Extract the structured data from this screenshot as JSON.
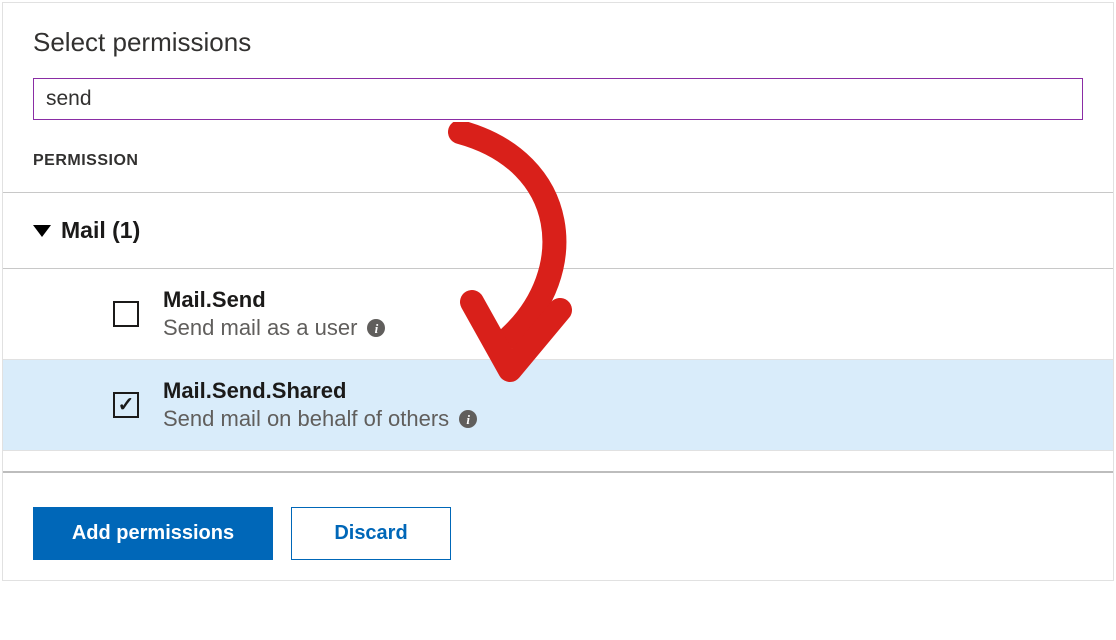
{
  "title": "Select permissions",
  "search": {
    "value": "send"
  },
  "columnHeader": "PERMISSION",
  "group": {
    "label": "Mail (1)"
  },
  "permissions": [
    {
      "name": "Mail.Send",
      "description": "Send mail as a user",
      "checked": false
    },
    {
      "name": "Mail.Send.Shared",
      "description": "Send mail on behalf of others",
      "checked": true
    }
  ],
  "buttons": {
    "primary": "Add permissions",
    "secondary": "Discard"
  }
}
